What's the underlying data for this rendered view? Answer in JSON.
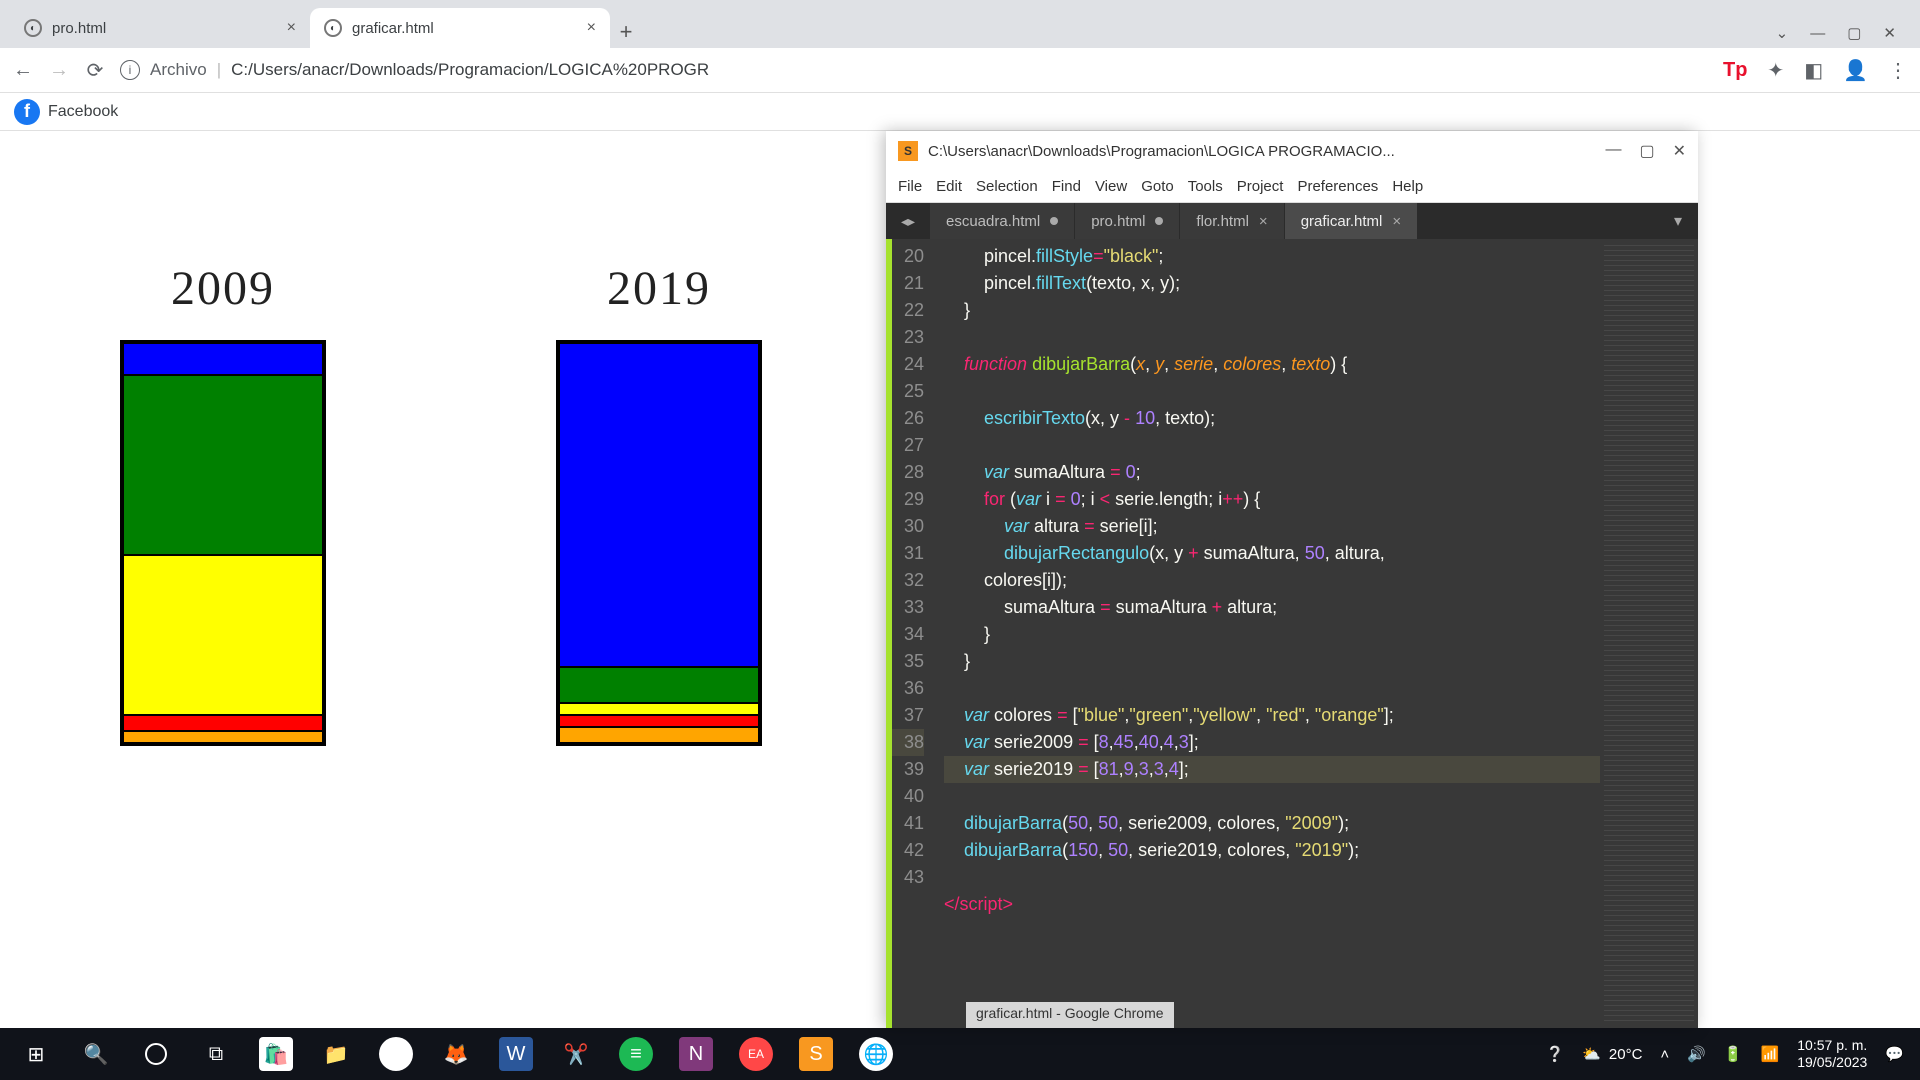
{
  "browser": {
    "tabs": [
      {
        "title": "pro.html",
        "active": false
      },
      {
        "title": "graficar.html",
        "active": true
      }
    ],
    "address_prefix": "Archivo",
    "address_path": "C:/Users/anacr/Downloads/Programacion/LOGICA%20PROGR",
    "bookmark": {
      "label": "Facebook"
    }
  },
  "chart_data": {
    "type": "bar",
    "stacked": true,
    "colors": [
      "blue",
      "green",
      "yellow",
      "red",
      "orange"
    ],
    "series": [
      {
        "name": "2009",
        "values": [
          8,
          45,
          40,
          4,
          3
        ]
      },
      {
        "name": "2019",
        "values": [
          81,
          9,
          3,
          3,
          4
        ]
      }
    ],
    "segment_labels": [
      "blue",
      "green",
      "yellow",
      "red",
      "orange"
    ],
    "pixel_scale": 4,
    "title": "",
    "xlabel": "",
    "ylabel": ""
  },
  "sublime": {
    "titlebar": "C:\\Users\\anacr\\Downloads\\Programacion\\LOGICA PROGRAMACIO...",
    "menu": [
      "File",
      "Edit",
      "Selection",
      "Find",
      "View",
      "Goto",
      "Tools",
      "Project",
      "Preferences",
      "Help"
    ],
    "tabs": [
      {
        "name": "escuadra.html",
        "dirty": true,
        "closeable": false
      },
      {
        "name": "pro.html",
        "dirty": true,
        "closeable": false
      },
      {
        "name": "flor.html",
        "dirty": false,
        "closeable": true
      },
      {
        "name": "graficar.html",
        "dirty": false,
        "closeable": true,
        "active": true
      }
    ],
    "first_line_no": 20,
    "highlight_line_no": 38,
    "status": "graficar.html - Google Chrome",
    "code_lines": [
      "        pincel.<call>fillStyle</call><op>=</op><str>\"black\"</str>;",
      "        pincel.<call>fillText</call>(texto, x, y);",
      "    }",
      "",
      "    <kw>function</kw> <fn>dibujarBarra</fn>(<arg>x</arg>, <arg>y</arg>, <arg>serie</arg>, <arg>colores</arg>, <arg>texto</arg>) {",
      "",
      "        <call>escribirTexto</call>(x, y <op>-</op> <num>10</num>, texto);",
      "",
      "        <storage>var</storage> sumaAltura <op>=</op> <num>0</num>;",
      "        <kw2>for</kw2> (<storage>var</storage> i <op>=</op> <num>0</num>; i <op><</op> serie.length; i<op>++</op>) {",
      "            <storage>var</storage> altura <op>=</op> serie[i];",
      "            <call>dibujarRectangulo</call>(x, y <op>+</op> sumaAltura, <num>50</num>, altura, colores[i]);",
      "            sumaAltura <op>=</op> sumaAltura <op>+</op> altura;",
      "        }",
      "    }",
      "",
      "    <storage>var</storage> colores <op>=</op> [<str>\"blue\"</str>,<str>\"green\"</str>,<str>\"yellow\"</str>, <str>\"red\"</str>, <str>\"orange\"</str>];",
      "    <storage>var</storage> serie2009 <op>=</op> [<num>8</num>,<num>45</num>,<num>40</num>,<num>4</num>,<num>3</num>];",
      "    <storage>var</storage> serie2019 <op>=</op> [<num>81</num>,<num>9</num>,<num>3</num>,<num>3</num>,<num>4</num>];",
      "",
      "    <call>dibujarBarra</call>(<num>50</num>, <num>50</num>, serie2009, colores, <str>\"2009\"</str>);",
      "    <call>dibujarBarra</call>(<num>150</num>, <num>50</num>, serie2019, colores, <str>\"2019\"</str>);",
      "",
      "<op></</op><kw2>script</kw2><op>></op>"
    ]
  },
  "taskbar": {
    "weather": "20°C",
    "time": "10:57 p. m.",
    "date": "19/05/2023"
  }
}
